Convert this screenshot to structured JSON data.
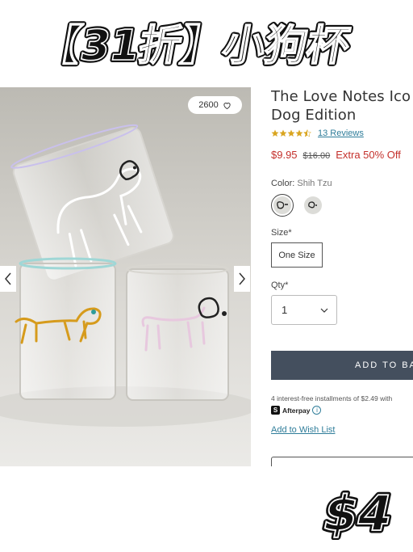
{
  "banner": {
    "title": "【31折】小狗杯"
  },
  "gallery": {
    "like_count": "2600",
    "icons": {
      "like": "heart-icon",
      "prev": "chevron-left-icon",
      "next": "chevron-right-icon"
    }
  },
  "product": {
    "title_line1": "The Love Notes Ico",
    "title_line2": "Dog Edition",
    "rating": 4.5,
    "reviews_label": "13 Reviews",
    "price_now": "$9.95",
    "price_was": "$16.00",
    "price_extra": "Extra 50% Off",
    "color_label": "Color:",
    "color_value": "Shih Tzu",
    "size_label": "Size*",
    "size_option": "One Size",
    "qty_label": "Qty*",
    "qty_value": "1",
    "add_to_bag": "ADD TO BA",
    "installments": "4 interest-free installments of $2.49 with",
    "afterpay_label": "Afterpay",
    "afterpay_info": "i",
    "wishlist": "Add to Wish List"
  },
  "sticker": {
    "price": "$4"
  },
  "colors": {
    "accent_link": "#2f7d9a",
    "sale_red": "#c4302b",
    "button_bg": "#444f5e",
    "star": "#d9a520"
  }
}
